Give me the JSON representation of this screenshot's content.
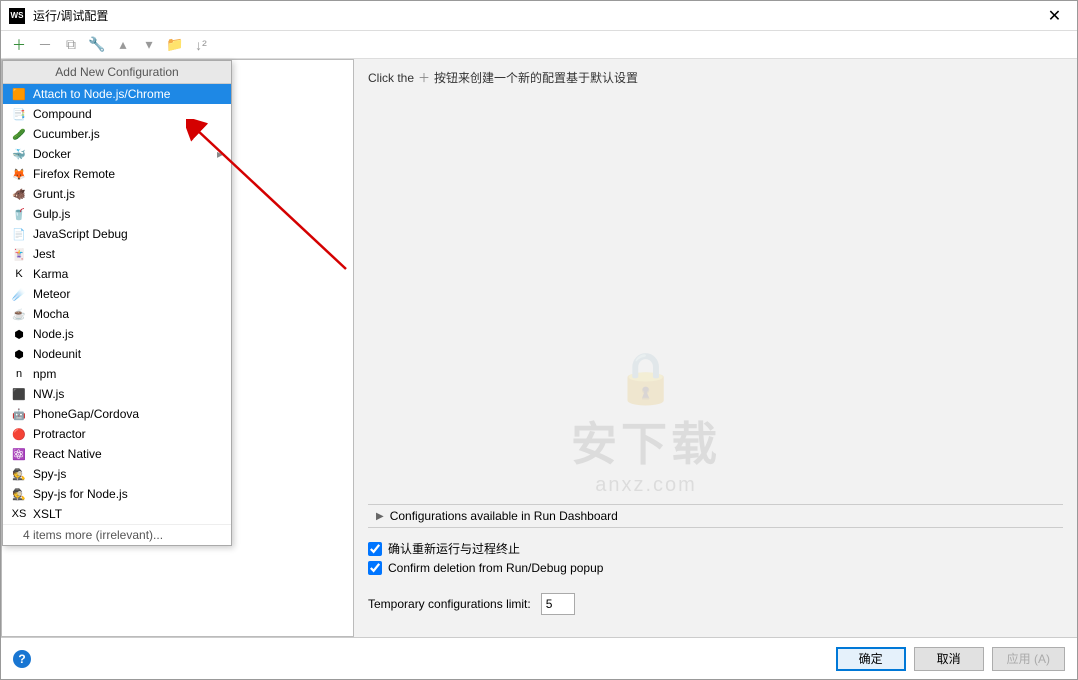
{
  "title": "运行/调试配置",
  "app_icon_text": "WS",
  "hint_prefix": "Click the",
  "hint_suffix": "按钮来创建一个新的配置基于默认设置",
  "dropdown": {
    "header": "Add New Configuration",
    "items": [
      {
        "label": "Attach to Node.js/Chrome",
        "icon": "🟧",
        "selected": true,
        "submenu": false
      },
      {
        "label": "Compound",
        "icon": "📑",
        "submenu": false
      },
      {
        "label": "Cucumber.js",
        "icon": "🥒",
        "submenu": false
      },
      {
        "label": "Docker",
        "icon": "🐳",
        "submenu": true
      },
      {
        "label": "Firefox Remote",
        "icon": "🦊",
        "submenu": false
      },
      {
        "label": "Grunt.js",
        "icon": "🐗",
        "submenu": false
      },
      {
        "label": "Gulp.js",
        "icon": "🥤",
        "submenu": false
      },
      {
        "label": "JavaScript Debug",
        "icon": "📄",
        "submenu": false
      },
      {
        "label": "Jest",
        "icon": "🃏",
        "submenu": false
      },
      {
        "label": "Karma",
        "icon": "K",
        "submenu": false
      },
      {
        "label": "Meteor",
        "icon": "☄️",
        "submenu": false
      },
      {
        "label": "Mocha",
        "icon": "☕",
        "submenu": false
      },
      {
        "label": "Node.js",
        "icon": "⬢",
        "submenu": false
      },
      {
        "label": "Nodeunit",
        "icon": "⬢",
        "submenu": false
      },
      {
        "label": "npm",
        "icon": "n",
        "submenu": false
      },
      {
        "label": "NW.js",
        "icon": "⬛",
        "submenu": false
      },
      {
        "label": "PhoneGap/Cordova",
        "icon": "🤖",
        "submenu": false
      },
      {
        "label": "Protractor",
        "icon": "🔴",
        "submenu": false
      },
      {
        "label": "React Native",
        "icon": "⚛️",
        "submenu": false
      },
      {
        "label": "Spy-js",
        "icon": "🕵️",
        "submenu": false
      },
      {
        "label": "Spy-js for Node.js",
        "icon": "🕵️",
        "submenu": false
      },
      {
        "label": "XSLT",
        "icon": "XS",
        "submenu": false
      }
    ],
    "footer": "4 items more (irrelevant)..."
  },
  "section_title": "Configurations available in Run Dashboard",
  "check1": "确认重新运行与过程终止",
  "check2": "Confirm deletion from Run/Debug popup",
  "limit_label": "Temporary configurations limit:",
  "limit_value": "5",
  "buttons": {
    "ok": "确定",
    "cancel": "取消",
    "apply": "应用 (A)"
  },
  "watermark": {
    "main": "安下载",
    "sub": "anxz.com"
  }
}
